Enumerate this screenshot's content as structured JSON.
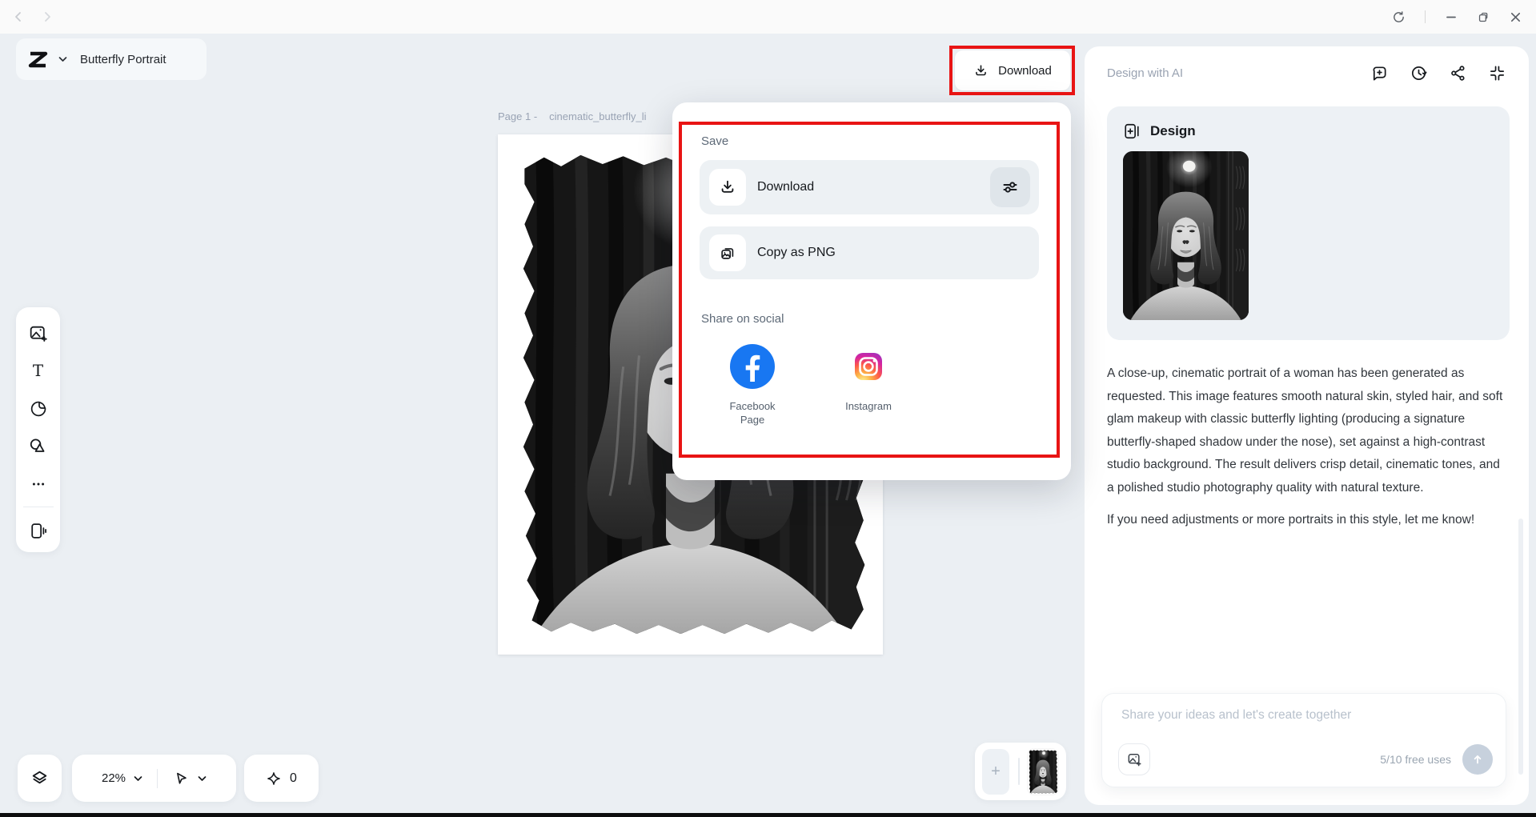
{
  "window": {
    "controls": [
      "refresh",
      "minimize",
      "restore",
      "close"
    ]
  },
  "header": {
    "project_title": "Butterfly Portrait",
    "download_label": "Download"
  },
  "left_toolbar": {
    "items": [
      "add-image",
      "text",
      "sticker",
      "elements",
      "more",
      "canvas-size"
    ]
  },
  "canvas": {
    "page_label": "Page 1 -",
    "file_name": "cinematic_butterfly_li",
    "zoom_value": "22%",
    "credits_value": "0",
    "add_page_label": "+"
  },
  "save_popup": {
    "save_heading": "Save",
    "download_label": "Download",
    "copy_label": "Copy as PNG",
    "share_heading": "Share on social",
    "social": [
      {
        "name": "Facebook Page",
        "line1": "Facebook",
        "line2": "Page"
      },
      {
        "name": "Instagram",
        "line1": "Instagram",
        "line2": ""
      }
    ]
  },
  "ai_panel": {
    "title": "Design with AI",
    "design_card_title": "Design",
    "message_p1": "A close-up, cinematic portrait of a woman has been generated as requested. This image features smooth natural skin, styled hair, and soft glam makeup with classic butterfly lighting (producing a signature butterfly-shaped shadow under the nose), set against a high-contrast studio background. The result delivers crisp detail, cinematic tones, and a polished studio photography quality with natural texture.",
    "message_p2": "If you need adjustments or more portraits in this style, let me know!",
    "chat_placeholder": "Share your ideas and let's create together",
    "free_uses": "5/10 free uses"
  },
  "colors": {
    "annotation_red": "#e81414",
    "facebook_blue": "#1877f2",
    "send_button": "#c7d1dd",
    "panel_bg": "#ffffff",
    "app_bg": "#ebeff3"
  }
}
